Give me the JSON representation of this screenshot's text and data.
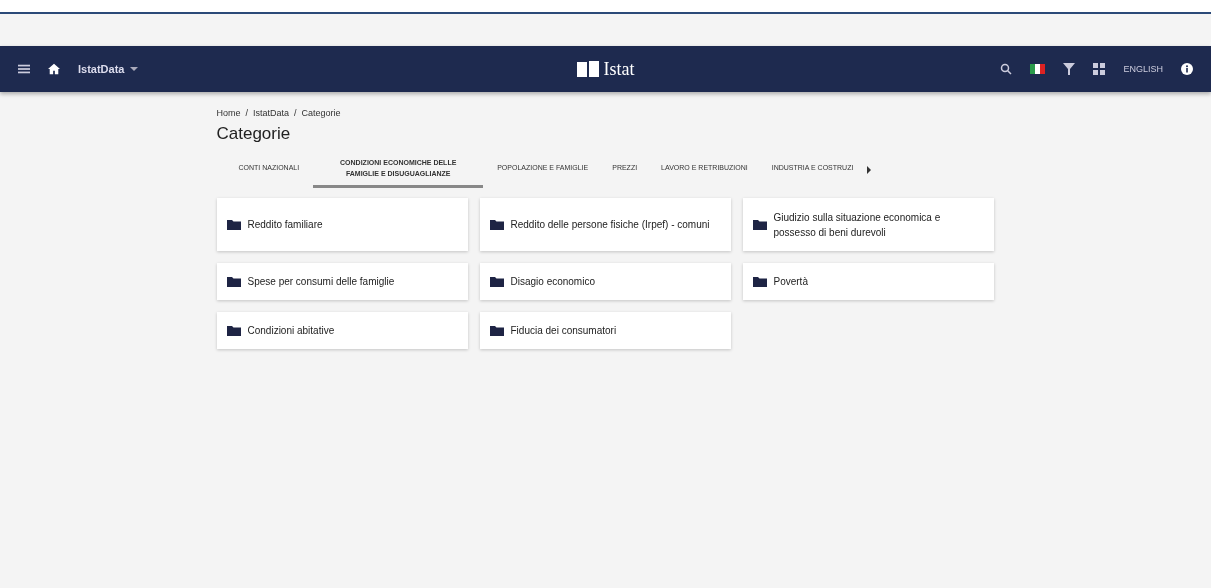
{
  "navbar": {
    "app_name": "IstatData",
    "logo_text": "Istat",
    "language": "ENGLISH"
  },
  "breadcrumb": {
    "separator": "/",
    "items": [
      "Home",
      "IstatData",
      "Categorie"
    ]
  },
  "title": "Categorie",
  "tabs": [
    {
      "label": "CONTI NAZIONALI",
      "selected": false
    },
    {
      "label": "CONDIZIONI ECONOMICHE DELLE FAMIGLIE E DISUGUAGLIANZE",
      "selected": true
    },
    {
      "label": "POPOLAZIONE E FAMIGLIE",
      "selected": false
    },
    {
      "label": "PREZZI",
      "selected": false
    },
    {
      "label": "LAVORO E RETRIBUZIONI",
      "selected": false
    },
    {
      "label": "INDUSTRIA E COSTRUZI",
      "selected": false
    }
  ],
  "categories": [
    {
      "label": "Reddito familiare"
    },
    {
      "label": "Reddito delle persone fisiche (Irpef) - comuni"
    },
    {
      "label": "Giudizio sulla situazione economica e possesso di beni durevoli"
    },
    {
      "label": "Spese per consumi delle famiglie"
    },
    {
      "label": "Disagio economico"
    },
    {
      "label": "Povertà"
    },
    {
      "label": "Condizioni abitative"
    },
    {
      "label": "Fiducia dei consumatori"
    }
  ]
}
